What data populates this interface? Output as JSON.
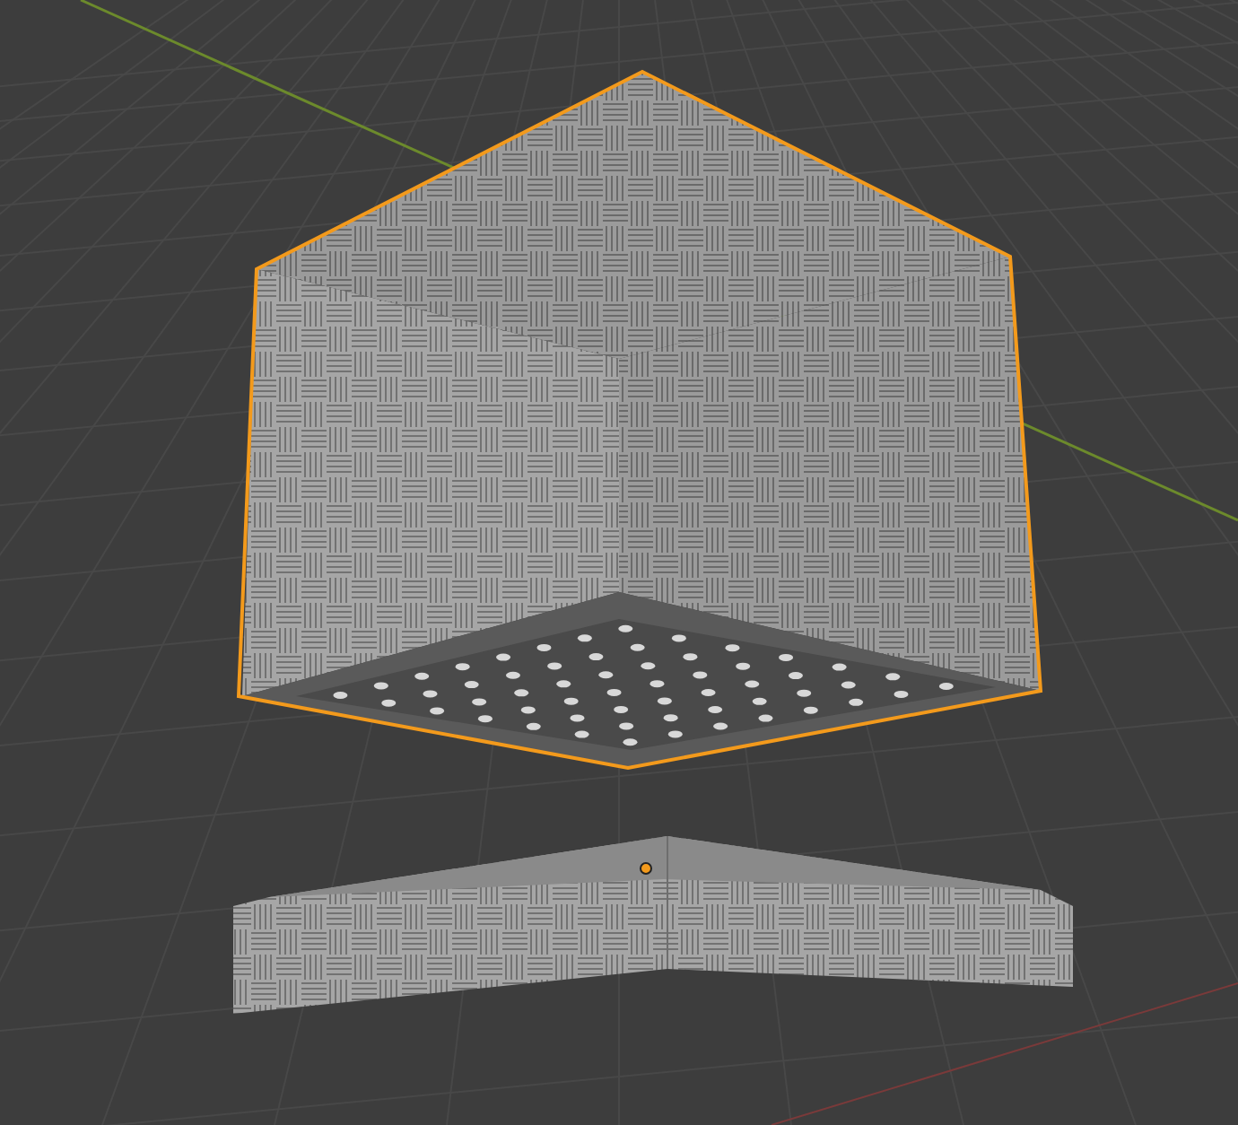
{
  "viewport": {
    "objects": [
      {
        "kind": "cube",
        "selected": true
      },
      {
        "kind": "slab",
        "selected": false
      }
    ]
  }
}
